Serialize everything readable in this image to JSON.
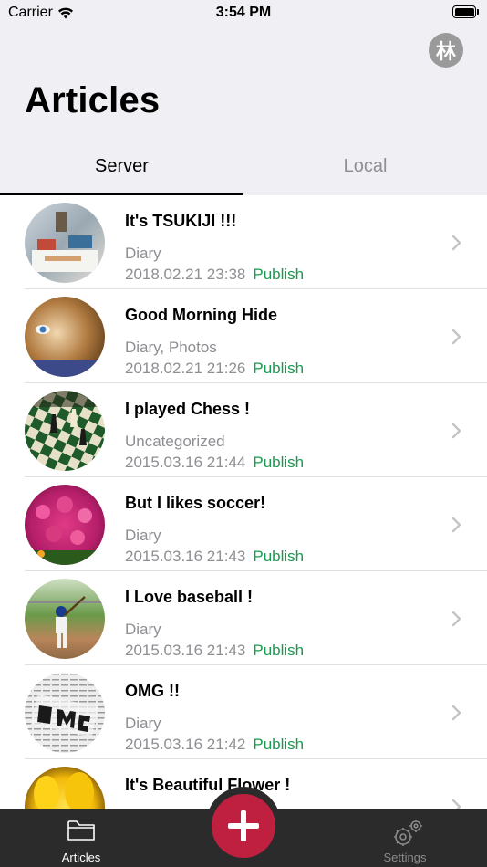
{
  "status_bar": {
    "carrier": "Carrier",
    "time": "3:54 PM"
  },
  "header": {
    "title": "Articles",
    "avatar_glyph": "林"
  },
  "tabs": [
    {
      "label": "Server",
      "selected": true
    },
    {
      "label": "Local",
      "selected": false
    }
  ],
  "articles": [
    {
      "title": "It's TSUKIJI !!!",
      "category": "Diary",
      "date": "2018.02.21 23:38",
      "status": "Publish",
      "thumbnail": "fish-market-photo"
    },
    {
      "title": "Good Morning Hide",
      "category": "Diary, Photos",
      "date": "2018.02.21 21:26",
      "status": "Publish",
      "thumbnail": "child-portrait-photo"
    },
    {
      "title": "I played Chess !",
      "category": "Uncategorized",
      "date": "2015.03.16 21:44",
      "status": "Publish",
      "thumbnail": "chess-board-photo"
    },
    {
      "title": "But I likes soccer!",
      "category": "Diary",
      "date": "2015.03.16 21:43",
      "status": "Publish",
      "thumbnail": "pink-flowers-photo"
    },
    {
      "title": "I Love baseball !",
      "category": "Diary",
      "date": "2015.03.16 21:43",
      "status": "Publish",
      "thumbnail": "baseball-batter-photo"
    },
    {
      "title": "OMG !!",
      "category": "Diary",
      "date": "2015.03.16 21:42",
      "status": "Publish",
      "thumbnail": "newspaper-omg-photo"
    },
    {
      "title": "It's Beautiful Flower !",
      "category": "",
      "date": "",
      "status": "",
      "thumbnail": "yellow-tulips-photo"
    }
  ],
  "tabbar": {
    "articles_label": "Articles",
    "settings_label": "Settings",
    "articles_icon": "folder-icon",
    "settings_icon": "gear-icon",
    "compose_icon": "plus-icon"
  },
  "colors": {
    "accent_red": "#c0203f",
    "publish_green": "#1a9a4f",
    "header_bg": "#efeff4",
    "tabbar_bg": "#2b2b2b"
  }
}
